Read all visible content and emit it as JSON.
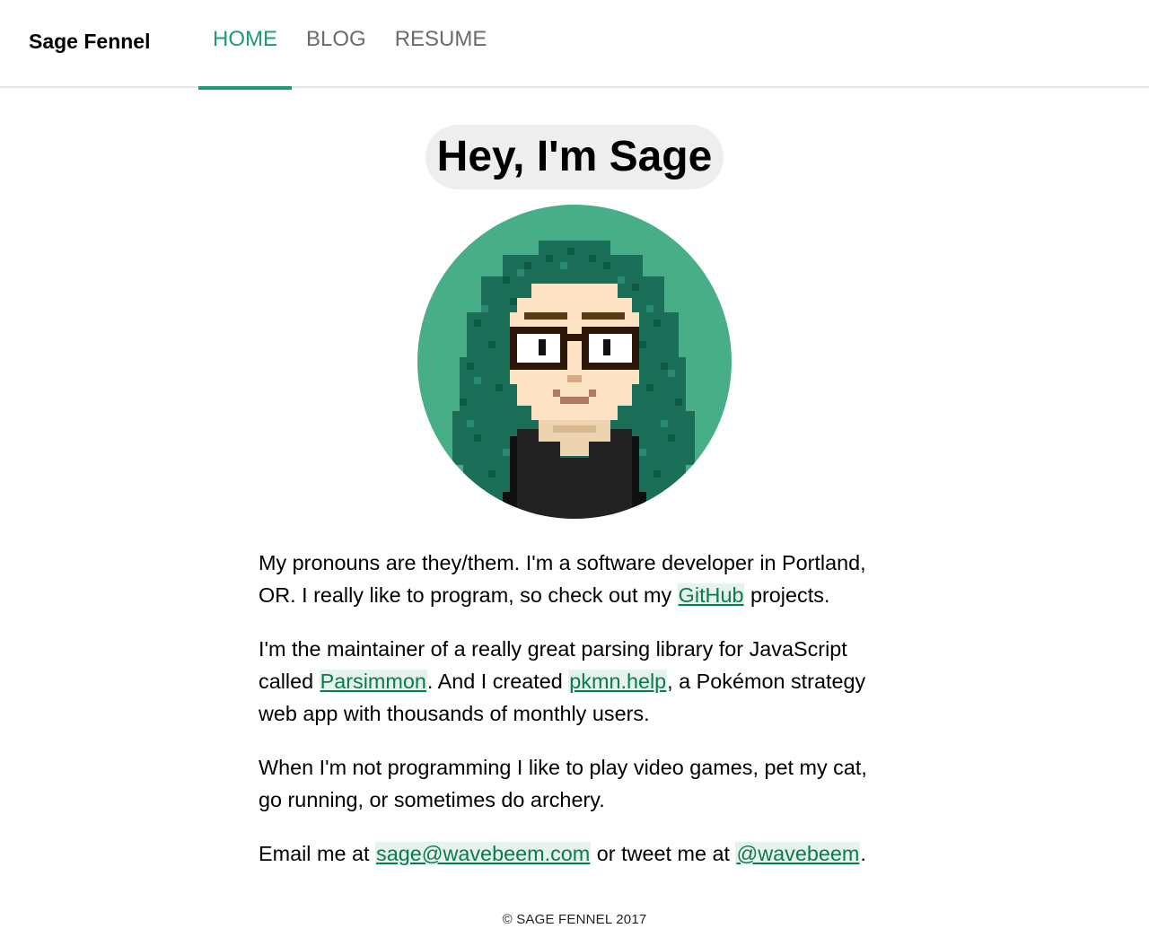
{
  "header": {
    "site_name": "Sage Fennel",
    "nav": [
      {
        "label": "HOME",
        "active": true
      },
      {
        "label": "BLOG",
        "active": false
      },
      {
        "label": "RESUME",
        "active": false
      }
    ]
  },
  "hero": {
    "greeting_prefix": "Hey, I'm ",
    "greeting_name": "Sage",
    "avatar_icon": "pixel-art-avatar-icon"
  },
  "paragraphs": {
    "p1": {
      "text_a": "My pronouns are they/them. I'm a software developer in Portland, OR. I really like to program, so check out my ",
      "link_github": "GitHub",
      "text_b": " projects."
    },
    "p2": {
      "text_a": "I'm the maintainer of a really great parsing library for JavaScript called ",
      "link_parsimmon": "Parsimmon",
      "text_b": ". And I created ",
      "link_pkmn": "pkmn.help",
      "text_c": ", a Pokémon strategy web app with thousands of monthly users."
    },
    "p3": {
      "text_a": "When I'm not programming I like to play video games, pet my cat, go running, or sometimes do archery."
    },
    "p4": {
      "text_a": "Email me at ",
      "link_email": "sage@wavebeem.com",
      "text_b": " or tweet me at ",
      "link_twitter": "@wavebeem",
      "text_c": "."
    }
  },
  "footer": {
    "copyright": "© SAGE FENNEL 2017"
  },
  "colors": {
    "accent": "#1f9c6c",
    "link": "#0c7a4f",
    "avatar_bg": "#48ae88",
    "hair": "#1b6e58",
    "skin": "#fde3c4",
    "shirt": "#222222"
  }
}
